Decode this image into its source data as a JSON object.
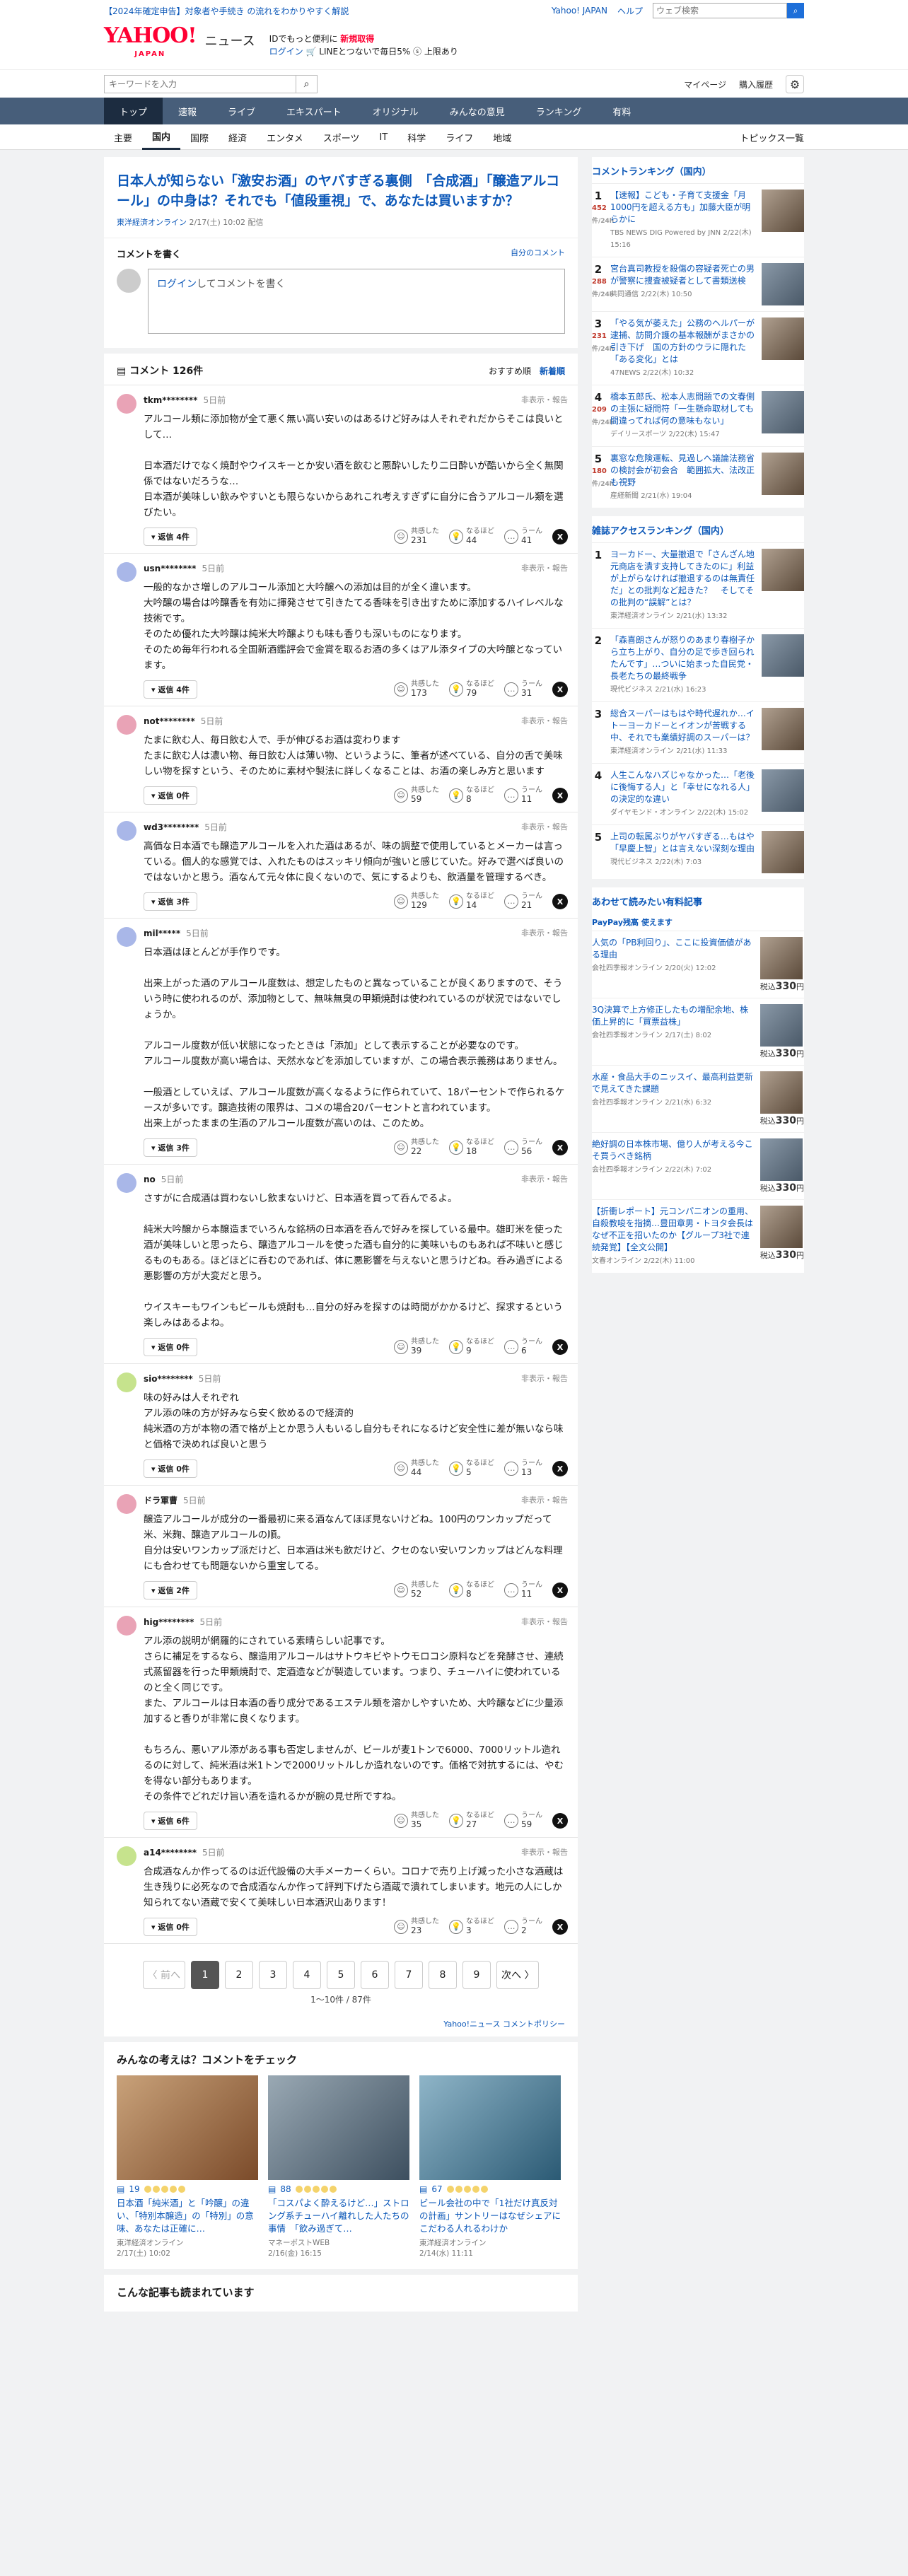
{
  "topbar": {
    "notice": "【2024年確定申告】対象者や手続き の流れをわかりやすく解説",
    "yahoo_japan": "Yahoo! JAPAN",
    "help": "ヘルプ",
    "search_placeholder": "ウェブ検索"
  },
  "header": {
    "logo": "YAHOO!",
    "logo_sub": "JAPAN",
    "logo_news": "ニュース",
    "promo_line1_a": "IDでもっと便利に",
    "promo_line1_b": "新規取得",
    "promo_line2_a": "ログイン",
    "promo_line2_b": "🛒 LINEとつないで毎日5% ⓢ 上限あり"
  },
  "search": {
    "placeholder": "キーワードを入力",
    "mypage": "マイページ",
    "purchase": "購入履歴"
  },
  "gnav": [
    "トップ",
    "速報",
    "ライブ",
    "エキスパート",
    "オリジナル",
    "みんなの意見",
    "ランキング",
    "有料"
  ],
  "subnav": [
    "主要",
    "国内",
    "国際",
    "経済",
    "エンタメ",
    "スポーツ",
    "IT",
    "科学",
    "ライフ",
    "地域"
  ],
  "subnav_topics": "トピックス一覧",
  "article": {
    "title": "日本人が知らない「激安お酒」のヤバすぎる裏側　「合成酒」「醸造アルコール」の中身は？それでも「値段重視」で、あなたは買いますか？",
    "source": "東洋経済オンライン",
    "date": "2/17(土) 10:02",
    "delivered": "配信"
  },
  "post": {
    "heading": "コメントを書く",
    "own": "自分のコメント",
    "login": "ログイン",
    "box": "してコメントを書く"
  },
  "comments_head": {
    "title": "コメント 126件",
    "sort_rec": "おすすめ順",
    "sort_new": "新着順"
  },
  "labels": {
    "report": "非表示・報告",
    "reply": "返信",
    "kyokan": "共感した",
    "naruhodo": "なるほど",
    "uun": "うーん"
  },
  "comments": [
    {
      "user": "tkm********",
      "time": "5日前",
      "text": "アルコール類に添加物が全て悪く無い高い安いのはあるけど好みは人それぞれだからそこは良いとして…\n\n日本酒だけでなく焼酎やウイスキーとか安い酒を飲むと悪酔いしたり二日酔いが酷いから全く無関係ではないだろうな…\n日本酒が美味しい飲みやすいとも限らないからあれこれ考えすぎずに自分に合うアルコール類を選びたい。",
      "replies": "返信 4件",
      "k": "231",
      "n": "44",
      "u": "41",
      "color": "#e9a3b6"
    },
    {
      "user": "usn********",
      "time": "5日前",
      "text": "一般的なかさ増しのアルコール添加と大吟醸への添加は目的が全く違います。\n大吟醸の場合は吟醸香を有効に揮発させて引きたてる香味を引き出すために添加するハイレベルな技術です。\nそのため優れた大吟醸は純米大吟醸よりも味も香りも深いものになります。\nそのため毎年行われる全国新酒鑑評会で金賞を取るお酒の多くはアル添タイプの大吟醸となっています。",
      "replies": "返信 4件",
      "k": "173",
      "n": "79",
      "u": "31",
      "color": "#a9b7e8"
    },
    {
      "user": "not********",
      "time": "5日前",
      "text": "たまに飲む人、毎日飲む人で、手が伸びるお酒は変わります\nたまに飲む人は濃い物、毎日飲む人は薄い物、というように、筆者が述べている、自分の舌で美味しい物を探すという、そのために素材や製法に詳しくなることは、お酒の楽しみ方と思います",
      "replies": "返信 0件",
      "k": "59",
      "n": "8",
      "u": "11",
      "color": "#e9a3b6"
    },
    {
      "user": "wd3********",
      "time": "5日前",
      "text": "高価な日本酒でも醸造アルコールを入れた酒はあるが、味の調整で使用しているとメーカーは言っている。個人的な感覚では、入れたものはスッキリ傾向が強いと感じていた。好みで選べば良いのではないかと思う。酒なんて元々体に良くないので、気にするよりも、飲酒量を管理するべき。",
      "replies": "返信 3件",
      "k": "129",
      "n": "14",
      "u": "21",
      "color": "#a9b7e8"
    },
    {
      "user": "mil*****",
      "time": "5日前",
      "text": "日本酒はほとんどが手作りです。\n\n出来上がった酒のアルコール度数は、想定したものと異なっていることが良くありますので、そういう時に使われるのが、添加物として、無味無臭の甲類焼酎は使われているのが状況ではないでしょうか。\n\nアルコール度数が低い状態になったときは「添加」として表示することが必要なのです。\nアルコール度数が高い場合は、天然水などを添加していますが、この場合表示義務はありません。\n\n一般酒としていえば、アルコール度数が高くなるように作られていて、18パーセントで作られるケースが多いです。醸造技術の限界は、コメの場合20パーセントと言われています。\n出来上がったままの生酒のアルコール度数が高いのは、このため。",
      "replies": "返信 3件",
      "k": "22",
      "n": "18",
      "u": "56",
      "color": "#a9b7e8"
    },
    {
      "user": "no",
      "time": "5日前",
      "text": "さすがに合成酒は買わないし飲まないけど、日本酒を買って呑んでるよ。\n\n純米大吟醸から本醸造までいろんな銘柄の日本酒を呑んで好みを探している最中。雄町米を使った酒が美味しいと思ったら、醸造アルコールを使った酒も自分的に美味いものもあれば不味いと感じるものもある。ほどほどに呑むのであれば、体に悪影響を与えないと思うけどね。呑み過ぎによる悪影響の方が大変だと思う。\n\nウイスキーもワインもビールも焼酎も…自分の好みを探すのは時間がかかるけど、探求するという楽しみはあるよね。",
      "replies": "返信 0件",
      "k": "39",
      "n": "9",
      "u": "6",
      "color": "#a9b7e8"
    },
    {
      "user": "sio********",
      "time": "5日前",
      "text": "味の好みは人それぞれ\nアル添の味の方が好みなら安く飲めるので経済的\n純米酒の方が本物の酒で格が上とか思う人もいるし自分もそれになるけど安全性に差が無いなら味と価格で決めれば良いと思う",
      "replies": "返信 0件",
      "k": "44",
      "n": "5",
      "u": "13",
      "color": "#c6e38d"
    },
    {
      "user": "ドラ軍曹",
      "time": "5日前",
      "text": "醸造アルコールが成分の一番最初に来る酒なんてほぼ見ないけどね。100円のワンカップだって米、米麹、醸造アルコールの順。\n自分は安いワンカップ派だけど、日本酒は米も飲だけど、クセのない安いワンカップはどんな料理にも合わせても問題ないから重宝してる。",
      "replies": "返信 2件",
      "k": "52",
      "n": "8",
      "u": "11",
      "color": "#e9a3b6"
    },
    {
      "user": "hig********",
      "time": "5日前",
      "text": "アル添の説明が網羅的にされている素晴らしい記事です。\nさらに補足をするなら、醸造用アルコールはサトウキビやトウモロコシ原料などを発酵させ、連続式蒸留器を行った甲類焼酎で、定酒造などが製造しています。つまり、チューハイに使われているのと全く同じです。\nまた、アルコールは日本酒の香り成分であるエステル類を溶かしやすいため、大吟醸などに少量添加すると香りが非常に良くなります。\n\nもちろん、悪いアル添がある事も否定しませんが、ビールが麦1トンで6000、7000リットル造れるのに対して、純米酒は米1トンで2000リットルしか造れないのです。価格で対抗するには、やむを得ない部分もあります。\nその条件でどれだけ旨い酒を造れるかが腕の見せ所ですね。",
      "replies": "返信 6件",
      "k": "35",
      "n": "27",
      "u": "59",
      "color": "#e9a3b6"
    },
    {
      "user": "a14********",
      "time": "5日前",
      "text": "合成酒なんか作ってるのは近代設備の大手メーカーくらい。コロナで売り上げ減った小さな酒蔵は生き残りに必死なので合成酒なんか作って評判下げたら酒蔵で潰れてしまいます。地元の人にしか知られてない酒蔵で安くて美味しい日本酒沢山あります！",
      "replies": "返信 0件",
      "k": "23",
      "n": "3",
      "u": "2",
      "color": "#c6e38d"
    }
  ],
  "pager": {
    "prev": "〈 前へ",
    "pages": [
      "1",
      "2",
      "3",
      "4",
      "5",
      "6",
      "7",
      "8",
      "9"
    ],
    "next": "次へ 〉",
    "count": "1〜10件 / 87件"
  },
  "policy": "Yahoo!ニュース コメントポリシー",
  "check": {
    "title": "みんなの考えは？コメントをチェック",
    "cards": [
      {
        "count": "19",
        "title": "日本酒「純米酒」と「吟醸」の違い、「特別本醸造」の「特別」の意味、あなたは正確に…",
        "src": "東洋経済オンライン",
        "date": "2/17(土) 10:02"
      },
      {
        "count": "88",
        "title": "「コスパよく酔えるけど…」ストロング系チューハイ離れした人たちの事情　「飲み過ぎて…",
        "src": "マネーポストWEB",
        "date": "2/16(金) 16:15"
      },
      {
        "count": "67",
        "title": "ビール会社の中で「1社だけ真反対の計画」サントリーはなぜシェアにこだわる人れるわけか",
        "src": "東洋経済オンライン",
        "date": "2/14(水) 11:11"
      }
    ]
  },
  "more": "こんな記事も読まれています",
  "ranking": {
    "title": "コメントランキング（国内）",
    "items": [
      {
        "rank": "1",
        "num": "452",
        "sub": "件/24h",
        "text": "【速報】こども・子育て支援金「月1000円を超える方も」加藤大臣が明らかに",
        "src": "TBS NEWS DIG Powered by JNN",
        "date": "2/22(木) 15:16"
      },
      {
        "rank": "2",
        "num": "288",
        "sub": "件/24h",
        "text": "宮台真司教授を殺傷の容疑者死亡の男が警察に捜査被疑者として書類送検",
        "src": "共同通信",
        "date": "2/22(木) 10:50"
      },
      {
        "rank": "3",
        "num": "231",
        "sub": "件/24h",
        "text": "「やる気が萎えた」公務のヘルパーが逮捕、訪問介護の基本報酬がまさかの引き下げ　国の方針のウラに隠れた「ある変化」とは",
        "src": "47NEWS",
        "date": "2/22(木) 10:32"
      },
      {
        "rank": "4",
        "num": "209",
        "sub": "件/24h",
        "text": "橋本五郎氏、松本人志問題での文春側の主張に疑問符「一生懸命取材しても間違ってれば何の意味もない」",
        "src": "デイリースポーツ",
        "date": "2/22(木) 15:47"
      },
      {
        "rank": "5",
        "num": "180",
        "sub": "件/24h",
        "text": "裏窓な危険運転、見過しへ議論法務省の検討会が初会合　範囲拡大、法改正も視野",
        "src": "産経新聞",
        "date": "2/21(水) 19:04"
      }
    ]
  },
  "access": {
    "title": "雑誌アクセスランキング（国内）",
    "items": [
      {
        "rank": "1",
        "text": "ヨーカドー、大量撤退で「さんざん地元商店を潰す支持してきたのに」利益が上がらなければ撤退するのは無責任だ」との批判など起きた？　そしてその批判の“誤解”とは？",
        "src": "東洋経済オンライン",
        "date": "2/21(水) 13:32"
      },
      {
        "rank": "2",
        "text": "「森喜朗さんが怒りのあまり春樹子から立ち上がり、自分の足で歩き回られたんです」…ついに始まった自民党・長老たちの最終戦争",
        "src": "現代ビジネス",
        "date": "2/21(水) 16:23"
      },
      {
        "rank": "3",
        "text": "総合スーパーはもはや時代遅れか…イトーヨーカドーとイオンが苦戦する中、それでも業績好調のスーパーは？",
        "src": "東洋経済オンライン",
        "date": "2/21(水) 11:33"
      },
      {
        "rank": "4",
        "text": "人生こんなハズじゃなかった…「老後に後悔する人」と「幸せになれる人」の決定的な違い",
        "src": "ダイヤモンド・オンライン",
        "date": "2/22(木) 15:02"
      },
      {
        "rank": "5",
        "text": "上司の転属ぶりがヤバすぎる…もはや「早慶上智」とは言えない深刻な理由",
        "src": "現代ビジネス",
        "date": "2/22(木) 7:03"
      }
    ]
  },
  "paid": {
    "title": "あわせて読みたい有料記事",
    "pp": "PayPay残高 使えます",
    "items": [
      {
        "text": "人気の「PB利回り」、ここに投資価値がある理由",
        "src": "会社四季報オンライン",
        "date": "2/20(火) 12:02",
        "price": "330"
      },
      {
        "text": "3Q決算で上方修正したもの増配余地、株価上昇的に「買票益株」",
        "src": "会社四季報オンライン",
        "date": "2/17(土) 8:02",
        "price": "330"
      },
      {
        "text": "水産・食品大手のニッスイ、最高利益更新で見えてきた課題",
        "src": "会社四季報オンライン",
        "date": "2/21(水) 6:32",
        "price": "330"
      },
      {
        "text": "絶好調の日本株市場、億り人が考える今こそ買うべき銘柄",
        "src": "会社四季報オンライン",
        "date": "2/22(木) 7:02",
        "price": "330"
      },
      {
        "text": "【折衝レポート】元コンパニオンの重用、自殺教唆を指摘…豊田章男・トヨタ会長はなぜ不正を招いたのか【グループ3社で連続発覚】【全文公開】",
        "src": "文春オンライン",
        "date": "2/22(木) 11:00",
        "price": "330"
      }
    ]
  },
  "price_prefix": "税込",
  "price_suffix": "円",
  "icons": {
    "search": "search-icon",
    "gear": "gear-icon",
    "kyokan": "smile-icon",
    "naruhodo": "bulb-icon",
    "uun": "thinking-icon",
    "x": "x-share-icon"
  }
}
